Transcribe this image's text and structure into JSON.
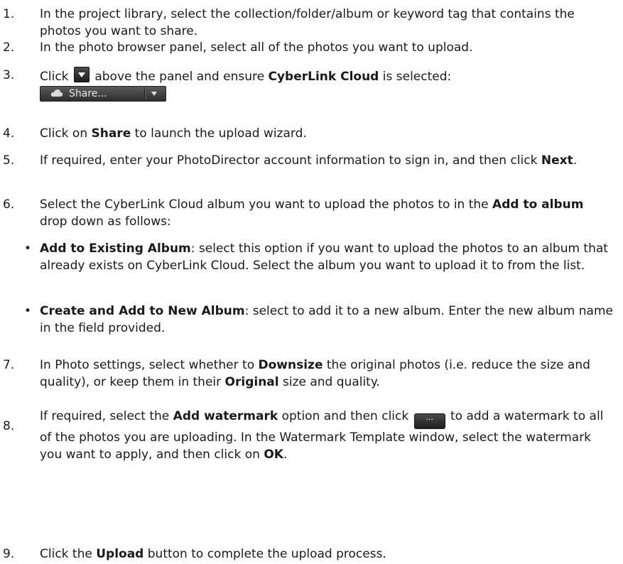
{
  "steps": [
    {
      "num": "1.",
      "parts": [
        "In the project library, select the collection/folder/album or keyword tag that contains the photos you want to share."
      ]
    },
    {
      "num": "2.",
      "text": "In the photo browser panel, select all of the photos you want to upload."
    },
    {
      "num": "3.",
      "before": "Click",
      "after": "above the panel and ensure",
      "bold": "CyberLink Cloud",
      "tail": "is selected:"
    },
    {
      "num": "4.",
      "before": "Click on",
      "bold": "Share",
      "after": "to launch the upload wizard."
    },
    {
      "num": "5.",
      "before": "If required, enter your PhotoDirector account information to sign in, and then click",
      "bold": "Next",
      "after": "."
    },
    {
      "num": "6.",
      "before": "Select the CyberLink Cloud album you want to upload the photos to in the",
      "bold": "Add to album",
      "after": "drop down as follows:"
    },
    {
      "num": "7.",
      "before": "In Photo settings, select whether to",
      "bold1": "Downsize",
      "mid": "the original photos (i.e. reduce the size and quality), or keep them in their",
      "bold2": "Original",
      "after": "size and quality."
    },
    {
      "num": "8.",
      "before": "If required, select the",
      "bold1": "Add watermark",
      "mid": "option and then click",
      "after1": "to add a watermark to all of the photos you are uploading. In the Watermark Template window, select the watermark you want to apply, and then click on",
      "bold2": "OK",
      "after2": "."
    },
    {
      "num": "9.",
      "before": "Click the",
      "bold": "Upload",
      "after": "button to complete the upload process."
    }
  ],
  "share_button": {
    "label": "Share...",
    "icon": "cloud-icon"
  },
  "dots_button": {
    "label": "···"
  },
  "bullets": [
    {
      "bold": "Add to Existing Album",
      "text": ": select this option if you want to upload the photos to an album that already exists on CyberLink Cloud. Select the album you want to upload it to from the list."
    },
    {
      "bold": "Create and Add to New Album",
      "text": ": select to add it to a new album. Enter the new album name in the field provided."
    }
  ]
}
